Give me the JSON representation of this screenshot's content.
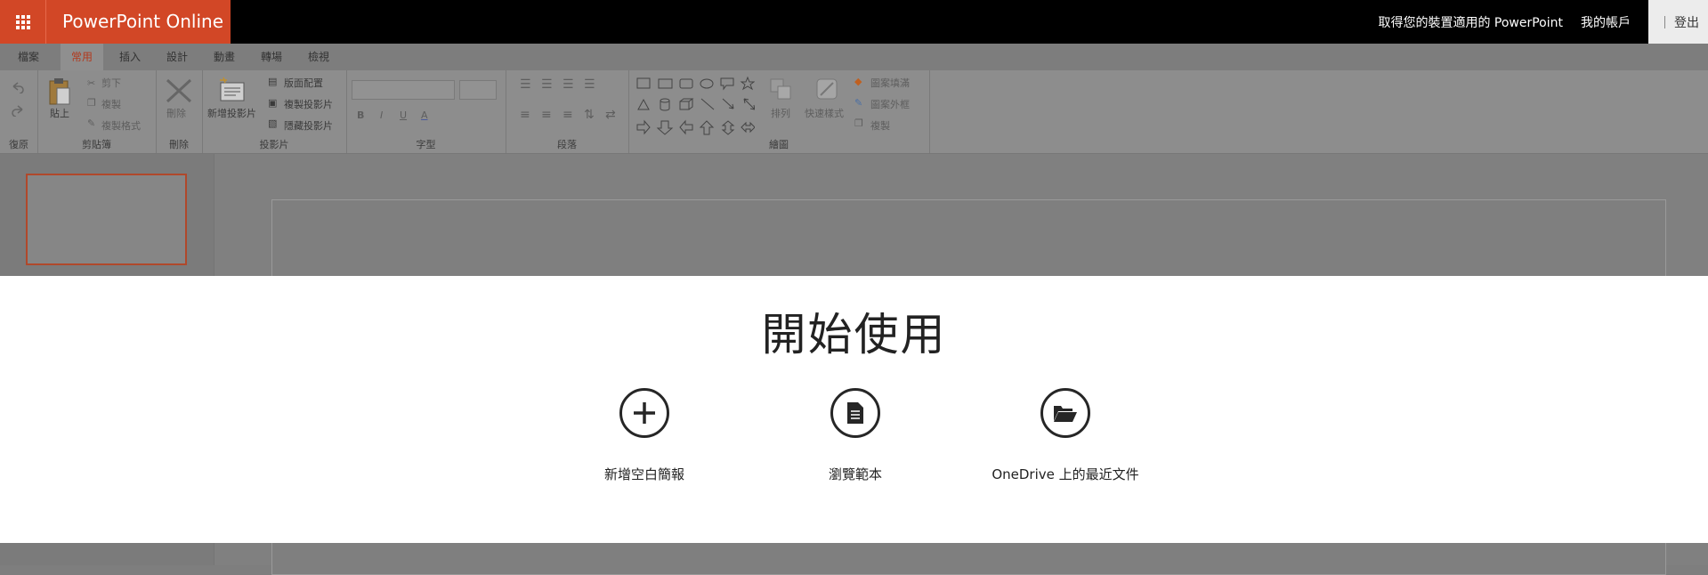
{
  "header": {
    "brand": "PowerPoint Online",
    "get_app_link": "取得您的裝置適用的 PowerPoint",
    "account_link": "我的帳戶",
    "signout": "登出"
  },
  "tabs": [
    "檔案",
    "常用",
    "插入",
    "設計",
    "動畫",
    "轉場",
    "檢視"
  ],
  "ribbon": {
    "undo_group": "復原",
    "clipboard": {
      "label": "剪貼簿",
      "paste": "貼上",
      "cut": "剪下",
      "copy": "複製",
      "format_painter": "複製格式"
    },
    "delete": {
      "label": "刪除",
      "button": "刪除"
    },
    "slides": {
      "label": "投影片",
      "new_slide": "新增投影片",
      "layout": "版面配置",
      "duplicate": "複製投影片",
      "hide": "隱藏投影片"
    },
    "font": {
      "label": "字型",
      "bold": "B",
      "italic": "I",
      "underline": "U",
      "color": "A"
    },
    "paragraph": {
      "label": "段落"
    },
    "drawing": {
      "label": "繪圖",
      "arrange": "排列",
      "quick_styles": "快速樣式",
      "shape_fill": "圖案填滿",
      "shape_outline": "圖案外框",
      "duplicate": "複製"
    }
  },
  "modal": {
    "title": "開始使用",
    "options": [
      {
        "label": "新增空白簡報",
        "icon": "plus-icon"
      },
      {
        "label": "瀏覽範本",
        "icon": "document-icon"
      },
      {
        "label": "OneDrive 上的最近文件",
        "icon": "folder-open-icon"
      }
    ]
  },
  "colors": {
    "brand": "#d24726",
    "topbar": "#000000",
    "active_tab": "#b23a1e"
  }
}
